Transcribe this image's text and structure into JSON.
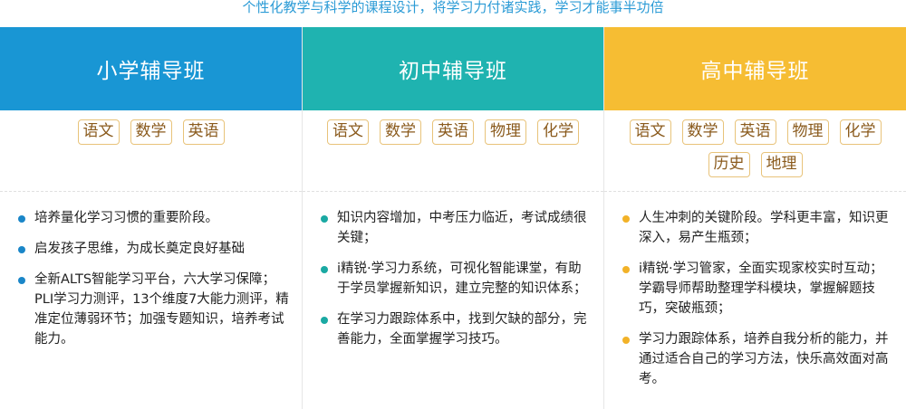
{
  "subtitle": "个性化教学与科学的课程设计，将学习力付诸实践，学习才能事半功倍",
  "columns": [
    {
      "title": "小学辅导班",
      "color": "#1996d4",
      "dot_color": "#1a86c8",
      "subjects": [
        "语文",
        "数学",
        "英语"
      ],
      "points": [
        "培养量化学习习惯的重要阶段。",
        "启发孩子思维，为成长奠定良好基础",
        "全新ALTS智能学习平台，六大学习保障；PLI学习力测评，13个维度7大能力测评，精准定位薄弱环节；加强专题知识，培养考试能力。"
      ]
    },
    {
      "title": "初中辅导班",
      "color": "#1fb3b0",
      "dot_color": "#1aa9a3",
      "subjects": [
        "语文",
        "数学",
        "英语",
        "物理",
        "化学"
      ],
      "points": [
        "知识内容增加，中考压力临近，考试成绩很关键；",
        "i精锐·学习力系统，可视化智能课堂，有助于学员掌握新知识，建立完整的知识体系；",
        "在学习力跟踪体系中，找到欠缺的部分，完善能力，全面掌握学习技巧。"
      ]
    },
    {
      "title": "高中辅导班",
      "color": "#f6bd33",
      "dot_color": "#f2b228",
      "subjects": [
        "语文",
        "数学",
        "英语",
        "物理",
        "化学",
        "历史",
        "地理"
      ],
      "points": [
        "人生冲刺的关键阶段。学科更丰富，知识更深入，易产生瓶颈；",
        "i精锐·学习管家，全面实现家校实时互动；学霸导师帮助整理学科模块，掌握解题技巧，突破瓶颈；",
        "学习力跟踪体系，培养自我分析的能力，并通过适合自己的学习方法，快乐高效面对高考。"
      ]
    }
  ]
}
